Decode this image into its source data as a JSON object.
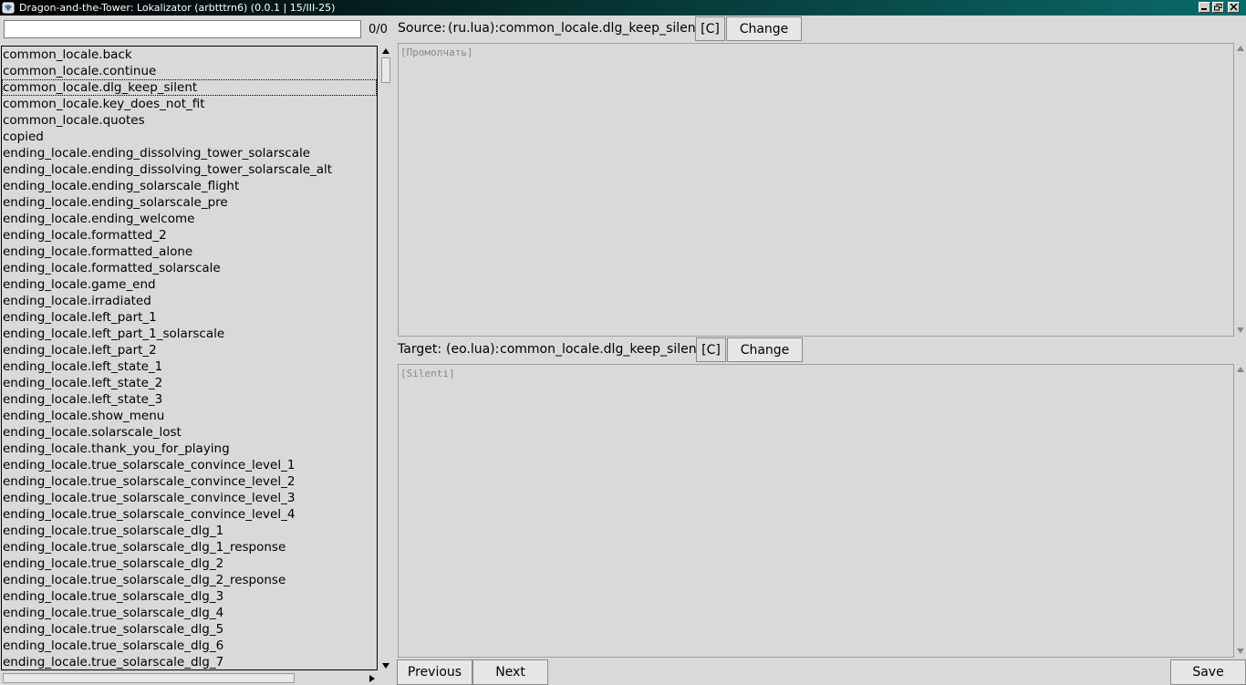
{
  "window": {
    "title": "Dragon-and-the-Tower: Lokalizator (arbtttrn6) (0.0.1 | 15/III-25)",
    "icon": "app-icon"
  },
  "search": {
    "value": "",
    "placeholder": "",
    "count": "0/0"
  },
  "keys": [
    "common_locale.back",
    "common_locale.continue",
    "common_locale.dlg_keep_silent",
    "common_locale.key_does_not_fit",
    "common_locale.quotes",
    "copied",
    "ending_locale.ending_dissolving_tower_solarscale",
    "ending_locale.ending_dissolving_tower_solarscale_alt",
    "ending_locale.ending_solarscale_flight",
    "ending_locale.ending_solarscale_pre",
    "ending_locale.ending_welcome",
    "ending_locale.formatted_2",
    "ending_locale.formatted_alone",
    "ending_locale.formatted_solarscale",
    "ending_locale.game_end",
    "ending_locale.irradiated",
    "ending_locale.left_part_1",
    "ending_locale.left_part_1_solarscale",
    "ending_locale.left_part_2",
    "ending_locale.left_state_1",
    "ending_locale.left_state_2",
    "ending_locale.left_state_3",
    "ending_locale.show_menu",
    "ending_locale.solarscale_lost",
    "ending_locale.thank_you_for_playing",
    "ending_locale.true_solarscale_convince_level_1",
    "ending_locale.true_solarscale_convince_level_2",
    "ending_locale.true_solarscale_convince_level_3",
    "ending_locale.true_solarscale_convince_level_4",
    "ending_locale.true_solarscale_dlg_1",
    "ending_locale.true_solarscale_dlg_1_response",
    "ending_locale.true_solarscale_dlg_2",
    "ending_locale.true_solarscale_dlg_2_response",
    "ending_locale.true_solarscale_dlg_3",
    "ending_locale.true_solarscale_dlg_4",
    "ending_locale.true_solarscale_dlg_5",
    "ending_locale.true_solarscale_dlg_6",
    "ending_locale.true_solarscale_dlg_7"
  ],
  "selected_index": 2,
  "source": {
    "label": "Source:",
    "file": "(ru.lua):",
    "key": "common_locale.dlg_keep_silent",
    "copy_label": "[C]",
    "change_label": "Change",
    "text": "[Промолчать]"
  },
  "target": {
    "label": "Target:",
    "file": "(eo.lua):",
    "key": "common_locale.dlg_keep_silent",
    "copy_label": "[C]",
    "change_label": "Change",
    "text": "[Silenti]"
  },
  "nav": {
    "previous_label": "Previous",
    "next_label": "Next",
    "save_label": "Save"
  }
}
